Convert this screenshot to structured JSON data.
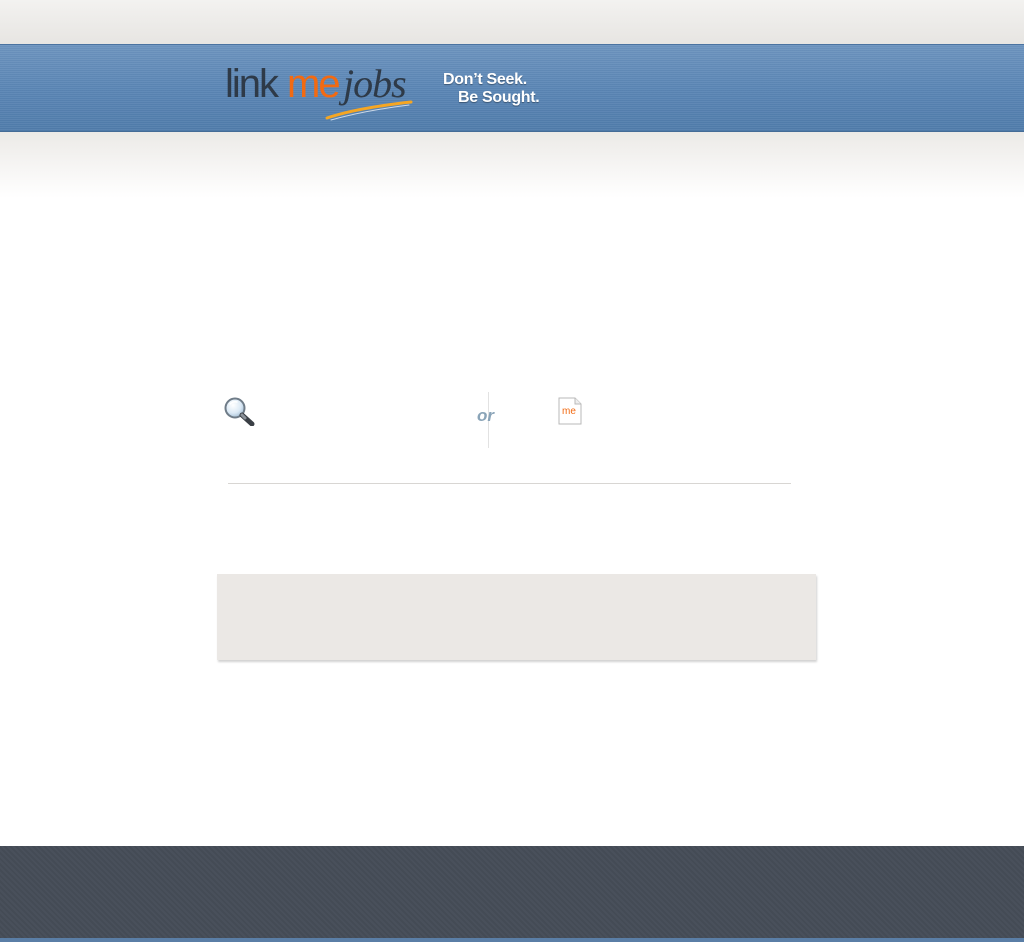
{
  "brand": {
    "logo_link": "link",
    "logo_me": "me",
    "logo_jobs": "jobs",
    "tagline_line1": "Don’t Seek.",
    "tagline_line2": "Be Sought."
  },
  "search_section": {
    "separator_text": "or",
    "search_icon": "magnifying-glass-icon",
    "resume_icon": "me-document-icon",
    "resume_icon_text": "me"
  },
  "colors": {
    "header_blue": "#5b86b5",
    "logo_orange": "#f26a12",
    "logo_dark": "#2e3a48",
    "footer_dark": "#454c57",
    "panel_grey": "#ebe8e5"
  }
}
